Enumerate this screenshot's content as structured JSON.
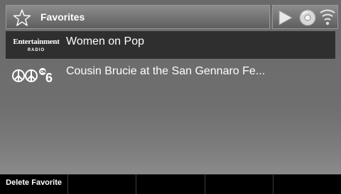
{
  "header": {
    "title": "Favorites",
    "icon": "star-outline-icon"
  },
  "status_icons": [
    "play-icon",
    "audio-disc-icon",
    "signal-strength-icon"
  ],
  "favorites": [
    {
      "logo_text": "Entertainment",
      "logo_sub": "RADIO",
      "label": "Women on Pop",
      "selected": true
    },
    {
      "logo_text": "60s on 6",
      "label": "Cousin Brucie at the San Gennaro Fe...",
      "selected": false
    }
  ],
  "softkeys": [
    {
      "label": "Delete Favorite"
    },
    {
      "label": ""
    },
    {
      "label": ""
    },
    {
      "label": ""
    },
    {
      "label": ""
    }
  ]
}
